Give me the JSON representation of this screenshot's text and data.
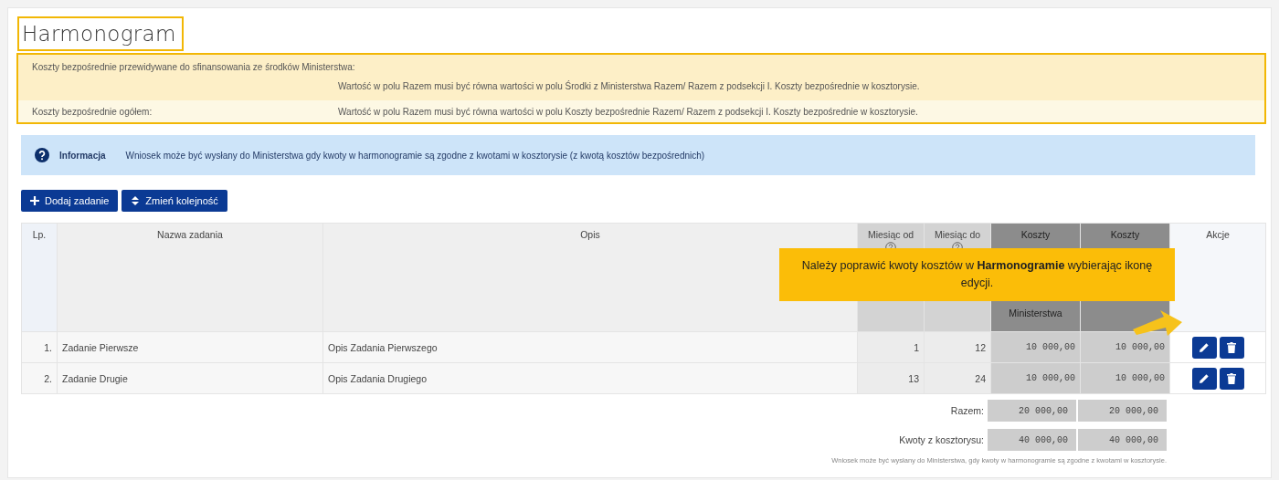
{
  "title": "Harmonogram",
  "cost_notes": [
    {
      "label": "Koszty bezpośrednie przewidywane do sfinansowania ze środków Ministerstwa:",
      "rule": "Wartość w polu Razem musi być równa wartości w polu Środki z Ministerstwa Razem/ Razem z podsekcji I. Koszty bezpośrednie w kosztorysie."
    },
    {
      "label": "Koszty bezpośrednie ogółem:",
      "rule": "Wartość w polu Razem musi być równa wartości w polu Koszty bezpośrednie Razem/ Razem z podsekcji I. Koszty bezpośrednie w kosztorysie."
    }
  ],
  "info": {
    "label": "Informacja",
    "text": "Wniosek może być wysłany do Ministerstwa gdy kwoty w harmonogramie są zgodne z kwotami w kosztorysie (z kwotą kosztów bezpośrednich)"
  },
  "buttons": [
    {
      "label": "Dodaj zadanie"
    },
    {
      "label": "Zmień kolejność"
    }
  ],
  "table": {
    "columns": [
      {
        "kind": "index",
        "label": "Lp."
      },
      {
        "kind": "text",
        "label": "Nazwa zadania"
      },
      {
        "kind": "text",
        "label": "Opis"
      },
      {
        "kind": "month",
        "label": "Miesiąc od"
      },
      {
        "kind": "month",
        "label": "Miesiąc do"
      },
      {
        "kind": "cost",
        "label": "Koszty",
        "label_bottom": "Ministerstwa"
      },
      {
        "kind": "cost",
        "label": "Koszty"
      },
      {
        "kind": "actions",
        "label": "Akcje"
      }
    ],
    "rows": [
      {
        "lp": "1.",
        "name": "Zadanie Pierwsze",
        "description": "Opis Zadania Pierwszego",
        "month_from": "1",
        "month_to": "12",
        "cost_1": "10 000,00",
        "cost_2": "10 000,00",
        "actions": [
          {
            "kind": "edit"
          },
          {
            "kind": "delete"
          }
        ]
      },
      {
        "lp": "2.",
        "name": "Zadanie Drugie",
        "description": "Opis Zadania Drugiego",
        "month_from": "13",
        "month_to": "24",
        "cost_1": "10 000,00",
        "cost_2": "10 000,00",
        "actions": [
          {
            "kind": "edit"
          },
          {
            "kind": "delete"
          }
        ]
      }
    ]
  },
  "totals": [
    {
      "label": "Razem:",
      "values": [
        "20 000,00",
        "20 000,00"
      ]
    },
    {
      "label": "Kwoty z kosztorysu:",
      "values": [
        "40 000,00",
        "40 000,00"
      ]
    }
  ],
  "footnote": "Wniosek może być wysłany do Ministerstwa, gdy kwoty w harmonogramie są zgodne z kwotami w kosztorysie.",
  "callout": {
    "text": "Należy poprawić kwoty kosztów w **Harmonogramie** wybierając ikonę edycji."
  }
}
